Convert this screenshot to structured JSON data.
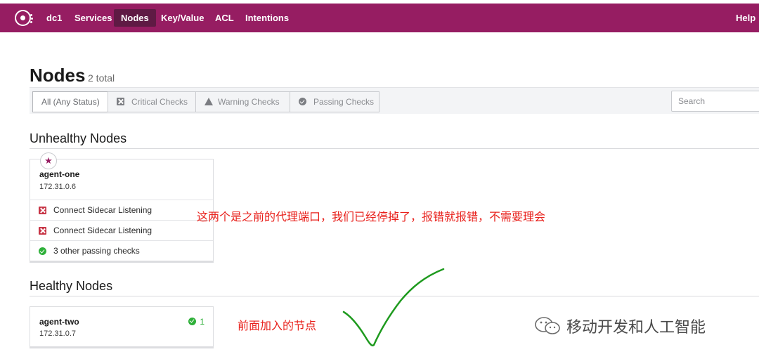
{
  "nav": {
    "dc": "dc1",
    "items": [
      "Services",
      "Nodes",
      "Key/Value",
      "ACL",
      "Intentions"
    ],
    "help": "Help"
  },
  "page": {
    "title": "Nodes",
    "count": "2 total"
  },
  "filters": {
    "all": "All (Any Status)",
    "critical": "Critical Checks",
    "warning": "Warning Checks",
    "passing": "Passing Checks",
    "search_placeholder": "Search"
  },
  "unhealthy": {
    "title": "Unhealthy Nodes",
    "node": {
      "name": "agent-one",
      "ip": "172.31.0.6",
      "checks": [
        "Connect Sidecar Listening",
        "Connect Sidecar Listening",
        "3 other passing checks"
      ]
    }
  },
  "healthy": {
    "title": "Healthy Nodes",
    "node": {
      "name": "agent-two",
      "ip": "172.31.0.7",
      "passing_count": "1"
    }
  },
  "annotations": {
    "note1": "这两个是之前的代理端口，我们已经停掉了，报错就报错，不需要理会",
    "note2": "前面加入的节点"
  },
  "watermark": "移动开发和人工智能",
  "colors": {
    "brand": "#961d62",
    "critical": "#c73445",
    "passing": "#2eb039",
    "annotation": "#e8201b",
    "checkmark": "#1e9a1e"
  }
}
